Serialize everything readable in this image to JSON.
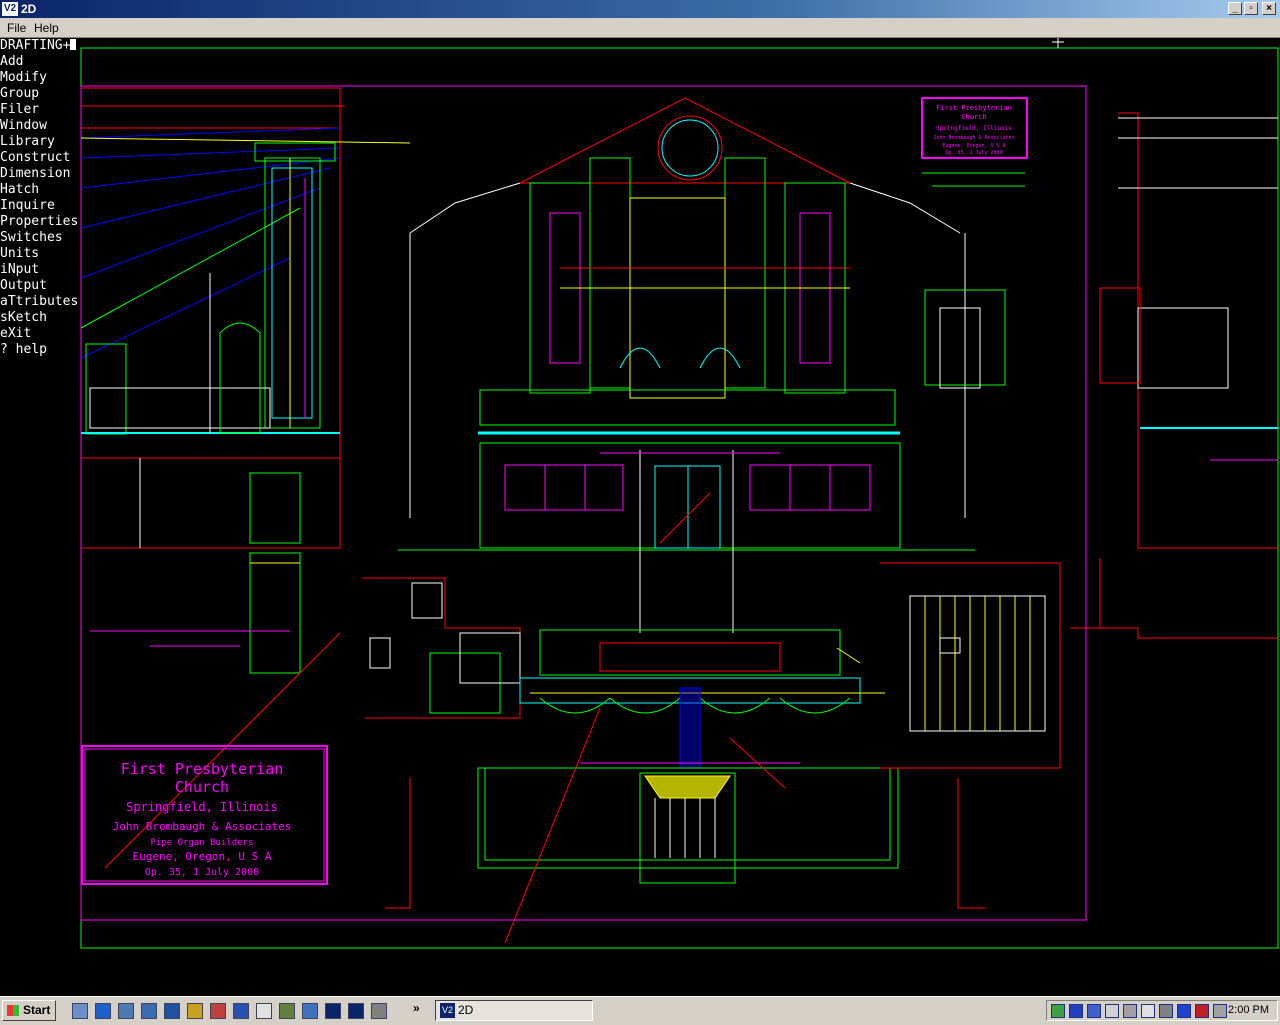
{
  "window": {
    "app_icon": "V2",
    "title": "2D",
    "buttons": [
      "_",
      "▫",
      "×"
    ]
  },
  "menubar": {
    "items": [
      "File",
      "Help"
    ]
  },
  "command_menu": {
    "header": "DRAFTING+",
    "items": [
      "Add",
      "Modify",
      "Group",
      "Filer",
      "Window",
      "Library",
      "Construct",
      "Dimension",
      "Hatch",
      "Inquire",
      "Properties",
      "Switches",
      "Units",
      "iNput",
      "Output",
      "aTtributes",
      "sKetch",
      "eXit",
      "? help"
    ]
  },
  "drawing": {
    "title_block_large": {
      "lines": [
        "First Presbyterian",
        "Church",
        "Springfield, Illinois",
        "John Brombaugh & Associates",
        "Pipe Organ Builders",
        "Eugene, Oregon,  U S A",
        "Op. 35,  1 July 2000"
      ]
    },
    "title_block_small": {
      "lines": [
        "First Presbyterian",
        "Church",
        "Springfield, Illinois",
        "John Brombaugh & Associates",
        "Eugene, Oregon,  U S A",
        "Op. 35,  1 July 2000"
      ]
    }
  },
  "taskbar": {
    "start_label": "Start",
    "chevron": "»",
    "task": {
      "icon": "V2",
      "label": "2D"
    },
    "clock": "2:00 PM"
  },
  "colors": {
    "accent_title": "#0a246a",
    "cad_magenta": "#ff00ff",
    "cad_green": "#00ff00",
    "cad_cyan": "#00ffff",
    "cad_yellow": "#ffff00",
    "cad_red": "#ff0000"
  }
}
